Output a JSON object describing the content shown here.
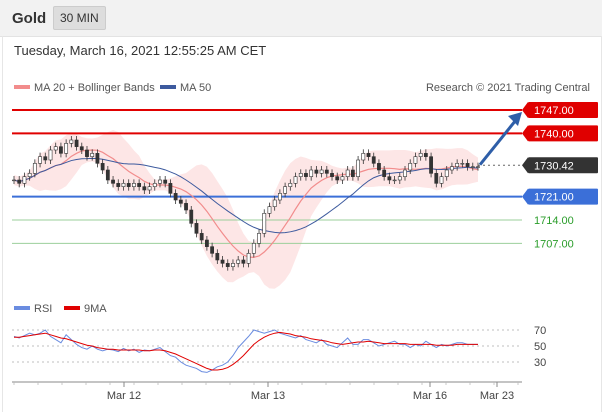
{
  "header": {
    "title": "Gold",
    "timeframe": "30 MIN"
  },
  "timestamp": "Tuesday, March 16, 2021 12:55:25 AM CET",
  "credit": "Research © 2021 Trading Central",
  "colors": {
    "resistance": "#e00000",
    "support": "#3b6fd8",
    "target": "#2a9d2a",
    "price": "#333333",
    "arrow": "#2e5ea8",
    "ma20": "#f28c8c",
    "ma50": "#3d5a9e",
    "band": "#fde3e3"
  },
  "chart_data": [
    {
      "type": "line",
      "legend": [
        "MA 20 + Bollinger Bands",
        "MA 50"
      ],
      "legend_position": "top-left",
      "x_tick_labels": [
        "Mar 12",
        "Mar 13",
        "Mar 16",
        "Mar 23"
      ],
      "ylim": [
        1696,
        1750
      ],
      "levels": [
        {
          "value": 1747.0,
          "label": "1747.00",
          "kind": "resistance"
        },
        {
          "value": 1740.0,
          "label": "1740.00",
          "kind": "resistance"
        },
        {
          "value": 1730.42,
          "label": "1730.42",
          "kind": "last-price"
        },
        {
          "value": 1721.0,
          "label": "1721.00",
          "kind": "support"
        },
        {
          "value": 1714.0,
          "label": "1714.00",
          "kind": "target"
        },
        {
          "value": 1707.0,
          "label": "1707.00",
          "kind": "target"
        }
      ],
      "close_series": [
        1726,
        1725,
        1727,
        1728,
        1731,
        1733,
        1732,
        1735,
        1736,
        1734,
        1737,
        1738,
        1736,
        1735,
        1733,
        1734,
        1731,
        1729,
        1726,
        1725,
        1724,
        1725,
        1724,
        1725,
        1724,
        1723,
        1724,
        1725,
        1726,
        1725,
        1722,
        1720,
        1719,
        1717,
        1713,
        1710,
        1708,
        1706,
        1704,
        1702,
        1701,
        1700,
        1701,
        1702,
        1701,
        1704,
        1707,
        1710,
        1716,
        1718,
        1720,
        1722,
        1724,
        1725,
        1727,
        1728,
        1727,
        1729,
        1728,
        1729,
        1728,
        1727,
        1726,
        1727,
        1729,
        1727,
        1732,
        1734,
        1733,
        1731,
        1729,
        1727,
        1726,
        1726,
        1727,
        1729,
        1731,
        1733,
        1734,
        1733,
        1728,
        1725,
        1727,
        1729,
        1730,
        1731,
        1731,
        1730,
        1730,
        1730
      ]
    },
    {
      "type": "line",
      "legend": [
        "RSI",
        "9MA"
      ],
      "legend_position": "top-left",
      "y_tick_labels": [
        "70",
        "50",
        "30"
      ],
      "ylim": [
        10,
        80
      ],
      "rsi_series": [
        62,
        60,
        63,
        66,
        64,
        66,
        70,
        62,
        58,
        54,
        64,
        58,
        52,
        48,
        46,
        50,
        46,
        44,
        46,
        45,
        43,
        47,
        44,
        46,
        42,
        45,
        44,
        46,
        48,
        43,
        38,
        36,
        30,
        26,
        24,
        22,
        18,
        17,
        20,
        24,
        26,
        30,
        38,
        48,
        55,
        62,
        70,
        68,
        66,
        68,
        70,
        66,
        64,
        62,
        60,
        63,
        58,
        56,
        54,
        58,
        52,
        50,
        48,
        54,
        60,
        52,
        52,
        58,
        58,
        54,
        50,
        52,
        54,
        56,
        52,
        52,
        48,
        52,
        50,
        56,
        52,
        48,
        52,
        50,
        52,
        54,
        54,
        52,
        52,
        52
      ],
      "ma_series": [
        61,
        61,
        62,
        63,
        64,
        65,
        66,
        64,
        62,
        60,
        59,
        57,
        55,
        53,
        51,
        50,
        48,
        47,
        46,
        46,
        45,
        45,
        45,
        45,
        45,
        44,
        44,
        45,
        45,
        44,
        42,
        40,
        37,
        34,
        31,
        28,
        25,
        22,
        20,
        20,
        21,
        23,
        27,
        32,
        38,
        45,
        52,
        57,
        61,
        64,
        66,
        67,
        66,
        65,
        63,
        62,
        61,
        59,
        58,
        57,
        56,
        54,
        53,
        52,
        53,
        54,
        55,
        55,
        56,
        55,
        54,
        53,
        53,
        53,
        53,
        53,
        52,
        52,
        52,
        52,
        52,
        51,
        51,
        51,
        51,
        52,
        52,
        52,
        52,
        52
      ]
    }
  ]
}
